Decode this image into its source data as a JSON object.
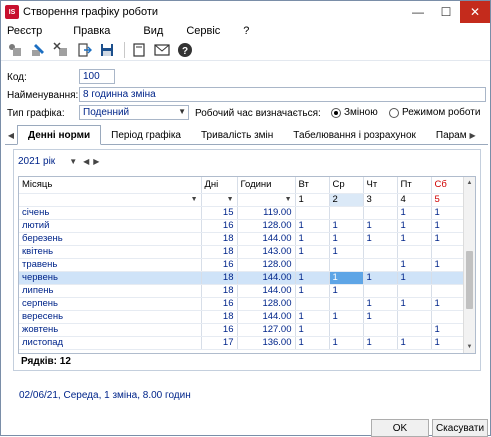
{
  "window": {
    "title": "Створення графіку роботи",
    "app_badge": "IS",
    "controls": {
      "minimize": "—",
      "maximize": "☐",
      "close": "✕"
    }
  },
  "menu": [
    "Реєстр",
    "Правка",
    "Вид",
    "Сервіс",
    "?"
  ],
  "toolbar_icons": [
    "add-icon",
    "edit-icon",
    "delete-icon",
    "export-icon",
    "save-icon",
    "document-icon",
    "mail-icon",
    "help-icon"
  ],
  "form": {
    "code_label": "Код:",
    "code_value": "100",
    "name_label": "Найменування:",
    "name_value": "8 годинна зміна",
    "type_label": "Тип графіка:",
    "type_value": "Поденний",
    "worktime_label": "Робочий час визначається:",
    "radio_shift": "Зміною",
    "radio_mode": "Режимом роботи",
    "radio_selected": "shift"
  },
  "tabs": [
    "Денні норми",
    "Період графіка",
    "Тривалість змін",
    "Табелювання і розрахунок",
    "Парам"
  ],
  "year_select": "2021 рік",
  "grid": {
    "columns": [
      "Місяць",
      "Дні",
      "Години",
      "Вт",
      "Ср",
      "Чт",
      "Пт",
      "Сб"
    ],
    "day_numbers": [
      "1",
      "2",
      "3",
      "4",
      "5"
    ],
    "rows": [
      {
        "month": "січень",
        "days": "15",
        "hours": "119.00",
        "d": [
          "",
          "",
          "",
          "1",
          "1"
        ]
      },
      {
        "month": "лютий",
        "days": "16",
        "hours": "128.00",
        "d": [
          "1",
          "1",
          "1",
          "1",
          "1"
        ]
      },
      {
        "month": "березень",
        "days": "18",
        "hours": "144.00",
        "d": [
          "1",
          "1",
          "1",
          "1",
          "1"
        ]
      },
      {
        "month": "квітень",
        "days": "18",
        "hours": "143.00",
        "d": [
          "1",
          "1",
          "",
          "",
          ""
        ]
      },
      {
        "month": "травень",
        "days": "16",
        "hours": "128.00",
        "d": [
          "",
          "",
          "",
          "1",
          "1"
        ]
      },
      {
        "month": "червень",
        "days": "18",
        "hours": "144.00",
        "d": [
          "1",
          "1",
          "1",
          "1",
          ""
        ]
      },
      {
        "month": "липень",
        "days": "18",
        "hours": "144.00",
        "d": [
          "1",
          "1",
          "",
          "",
          ""
        ]
      },
      {
        "month": "серпень",
        "days": "16",
        "hours": "128.00",
        "d": [
          "",
          "",
          "1",
          "1",
          "1"
        ]
      },
      {
        "month": "вересень",
        "days": "18",
        "hours": "144.00",
        "d": [
          "1",
          "1",
          "1",
          "",
          ""
        ]
      },
      {
        "month": "жовтень",
        "days": "16",
        "hours": "127.00",
        "d": [
          "1",
          "",
          "",
          "",
          "1"
        ]
      },
      {
        "month": "листопад",
        "days": "17",
        "hours": "136.00",
        "d": [
          "1",
          "1",
          "1",
          "1",
          "1"
        ]
      }
    ],
    "selected_row": 5,
    "rows_count": "Рядків: 12"
  },
  "status": "02/06/21, Середа, 1 зміна, 8.00 годин",
  "buttons": {
    "ok": "OK",
    "cancel": "Скасувати"
  },
  "colors": {
    "accent": "#00258a",
    "selection": "#cfe3f8",
    "selected_cell": "#5ea5e6",
    "weekend": "#d00000",
    "close": "#c42b1c"
  }
}
